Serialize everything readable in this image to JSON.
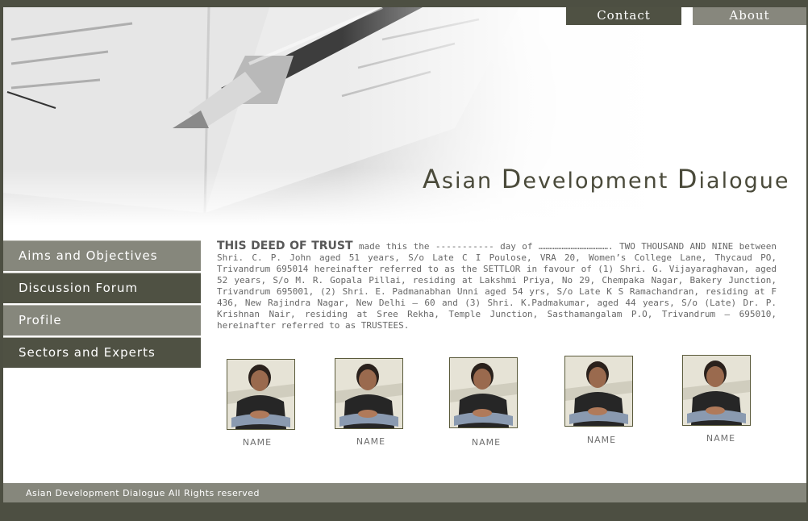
{
  "top_nav": {
    "contact": "Contact",
    "about": "About"
  },
  "site_title": {
    "a_big": "A",
    "a_rest": "sian ",
    "d_big": "D",
    "d_rest": "evelopment ",
    "d2_big": "D",
    "d2_rest": "ialogue"
  },
  "sidebar": {
    "items": [
      {
        "label": "Aims and Objectives"
      },
      {
        "label": "Discussion Forum"
      },
      {
        "label": "Profile"
      },
      {
        "label": "Sectors and Experts"
      }
    ]
  },
  "deed": {
    "lead": "THIS DEED OF TRUST",
    "body": " made this the ----------- day of ………………………………….  TWO THOUSAND AND NINE between Shri. C. P. John aged 51 years, S/o Late C I Poulose, VRA 20, Women’s College Lane, Thycaud PO, Trivandrum 695014 hereinafter referred to as the SETTLOR in favour of  (1) Shri. G. Vijayaraghavan, aged 52 years, S/o M. R. Gopala Pillai, residing at  Lakshmi Priya, No 29, Chempaka Nagar, Bakery Junction, Trivandrum 695001, (2) Shri. E. Padmanabhan Unni aged 54 yrs, S/o Late K S Ramachandran, residing at  F 436, New Rajindra Nagar, New Delhi – 60 and (3) Shri. K.Padmakumar, aged 44 years, S/o (Late) Dr. P. Krishnan Nair, residing at  Sree Rekha, Temple Junction, Sasthamangalam P.O, Trivandrum – 695010, hereinafter referred to as TRUSTEES."
  },
  "members": [
    {
      "name": "NAME"
    },
    {
      "name": "NAME"
    },
    {
      "name": "NAME"
    },
    {
      "name": "NAME"
    },
    {
      "name": "NAME"
    }
  ],
  "footer": {
    "text": "Asian Development Dialogue All Rights reserved"
  },
  "colors": {
    "dark": "#4f5143",
    "light": "#86877c",
    "page_bg": "#4d4f42"
  }
}
